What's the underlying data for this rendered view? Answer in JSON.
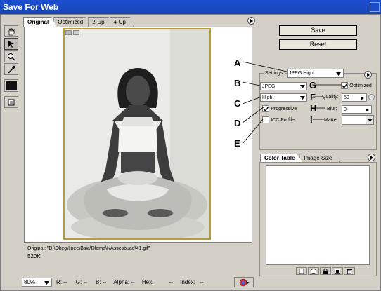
{
  "window": {
    "title": "Save For Web"
  },
  "tabs": [
    "Original",
    "Optimized",
    "2-Up",
    "4-Up"
  ],
  "buttons": {
    "save": "Save",
    "reset": "Reset"
  },
  "settings": {
    "label": "Settings:",
    "preset": "JPEG High",
    "format": "JPEG",
    "quality_preset": "High",
    "optimized_label": "Optimized",
    "quality_label": "Quality:",
    "quality_value": "50",
    "blur_label": "Blur:",
    "blur_value": "0",
    "matte_label": "Matte:",
    "progressive_label": "Progressive",
    "icc_label": "ICC Profile"
  },
  "callouts": [
    "A",
    "B",
    "C",
    "D",
    "E",
    "G",
    "F",
    "H",
    "I"
  ],
  "image_info": {
    "line1": "Original: \"D:\\Okeg\\Iinee\\Bsia\\Dlama\\NAssesbuad\\41.gif\"",
    "line2": "520K"
  },
  "color_panel": {
    "tab1": "Color Table",
    "tab2": "Image Size"
  },
  "status": {
    "zoom": "80%",
    "r": "R:",
    "r_val": "--",
    "g": "G:",
    "g_val": "--",
    "b": "B:",
    "b_val": "--",
    "alpha": "Alpha:",
    "alpha_val": "--",
    "hex": "Hex:",
    "hex_val": "--",
    "index": "Index:",
    "index_val": "--"
  }
}
